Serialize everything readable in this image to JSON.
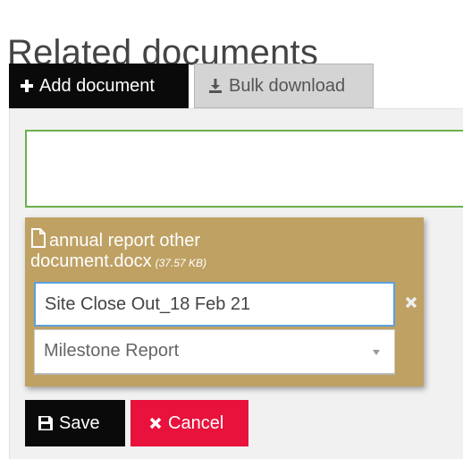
{
  "page": {
    "title": "Related documents"
  },
  "toolbar": {
    "add_label": "Add document",
    "bulk_label": "Bulk download"
  },
  "document": {
    "file_name": "annual report other document.docx",
    "file_size": "(37.57 KB)",
    "name_value": "Site Close Out_18 Feb 21",
    "type_value": "Milestone Report"
  },
  "actions": {
    "save_label": "Save",
    "cancel_label": "Cancel"
  },
  "colors": {
    "card_background": "#bea163",
    "dropzone_border": "#6ab04c",
    "cancel": "#e8123c",
    "primary": "#0a0a0a"
  },
  "icons": {
    "add": "plus-icon",
    "bulk": "download-icon",
    "file": "file-icon",
    "remove": "close-icon",
    "save": "floppy-icon",
    "cancel": "x-icon"
  }
}
